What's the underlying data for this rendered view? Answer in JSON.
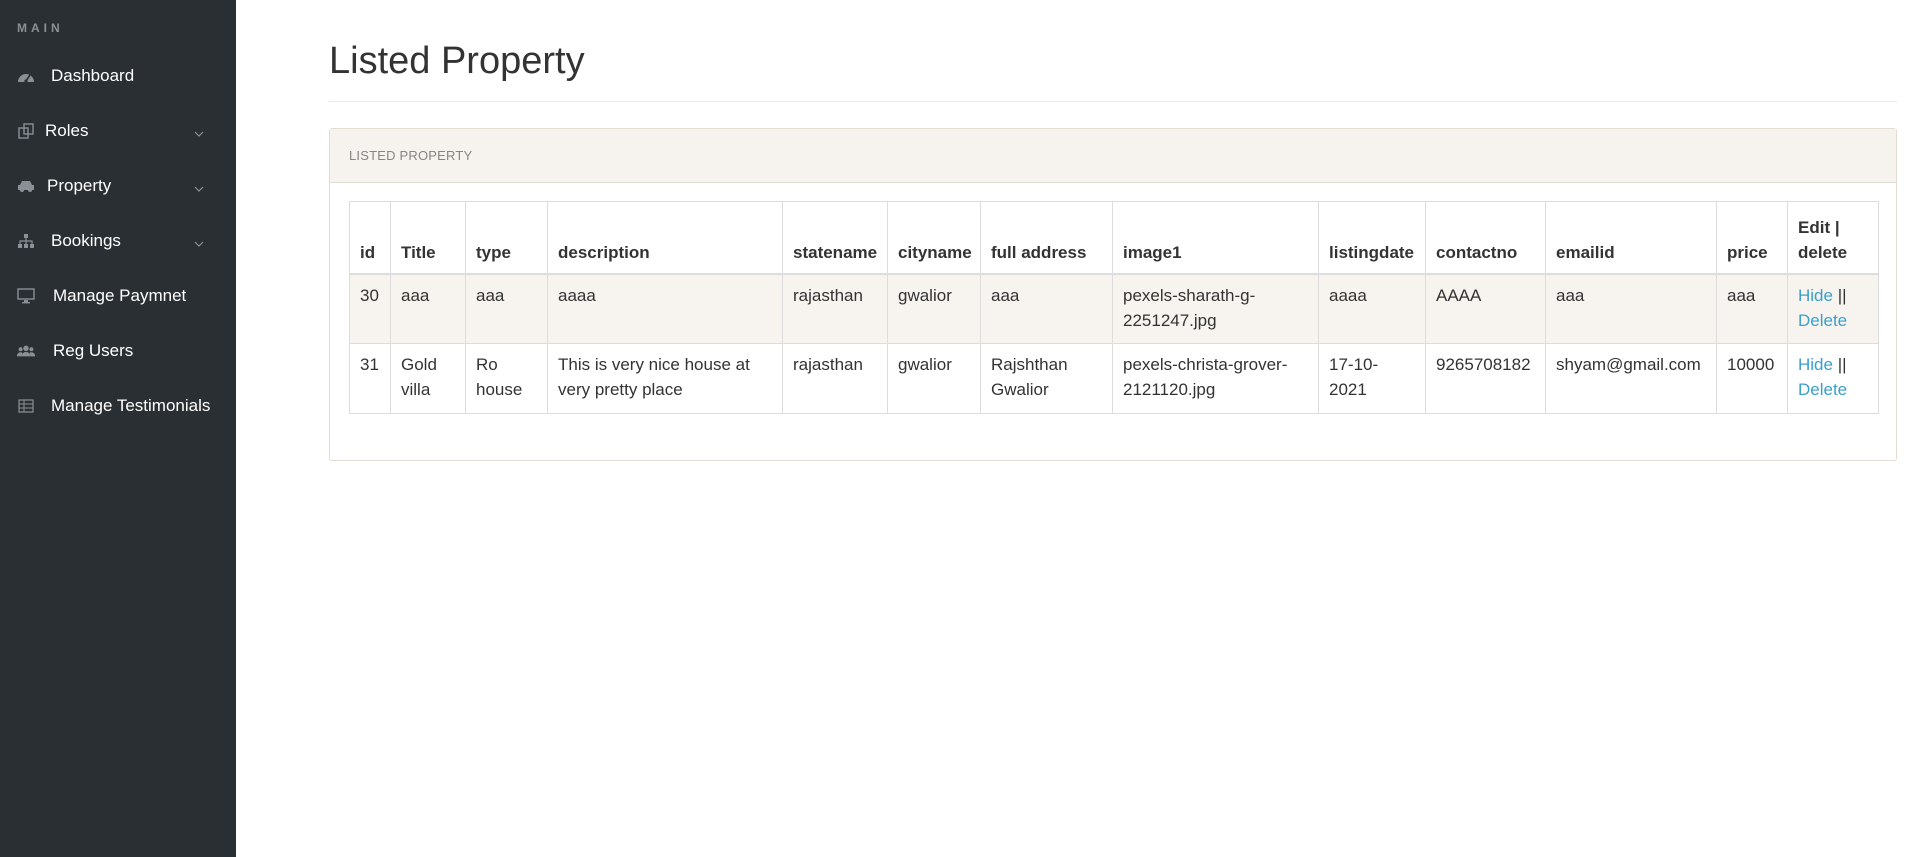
{
  "sidebar": {
    "heading": "MAIN",
    "items": [
      {
        "label": "Dashboard",
        "icon": "dashboard-icon",
        "has_children": false
      },
      {
        "label": "Roles",
        "icon": "copy-icon",
        "has_children": true
      },
      {
        "label": "Property",
        "icon": "car-icon",
        "has_children": true
      },
      {
        "label": "Bookings",
        "icon": "sitemap-icon",
        "has_children": true
      },
      {
        "label": "Manage Paymnet",
        "icon": "desktop-icon",
        "has_children": false
      },
      {
        "label": "Reg Users",
        "icon": "users-icon",
        "has_children": false
      },
      {
        "label": "Manage Testimonials",
        "icon": "table-icon",
        "has_children": false
      }
    ]
  },
  "main": {
    "title": "Listed Property",
    "panel": {
      "heading": "LISTED PROPERTY",
      "columns": [
        "id",
        "Title",
        "type",
        "description",
        "statename",
        "cityname",
        "full address",
        "image1",
        "listingdate",
        "contactno",
        "emailid",
        "price",
        "Edit | delete"
      ],
      "rows": [
        {
          "id": "30",
          "title": "aaa",
          "type": "aaa",
          "description": "aaaa",
          "statename": "rajasthan",
          "cityname": "gwalior",
          "full_address": "aaa",
          "image1": "pexels-sharath-g-2251247.jpg",
          "listingdate": "aaaa",
          "contactno": "AAAA",
          "emailid": "aaa",
          "price": "aaa",
          "hide": "Hide",
          "separator": "||",
          "delete": "Delete"
        },
        {
          "id": "31",
          "title": "Gold villa",
          "type": "Ro house",
          "description": "This is very nice house at very pretty place",
          "statename": "rajasthan",
          "cityname": "gwalior",
          "full_address": "Rajshthan Gwalior",
          "image1": "pexels-christa-grover-2121120.jpg",
          "listingdate": "17-10-2021",
          "contactno": "9265708182",
          "emailid": "shyam@gmail.com",
          "price": "10000",
          "hide": "Hide",
          "separator": "||",
          "delete": "Delete"
        }
      ]
    }
  },
  "colors": {
    "sidebar_bg": "#2a2f33",
    "link": "#3a9fcc",
    "panel_heading_bg": "#f6f3ee",
    "striped_row_bg": "#f7f4ef"
  }
}
